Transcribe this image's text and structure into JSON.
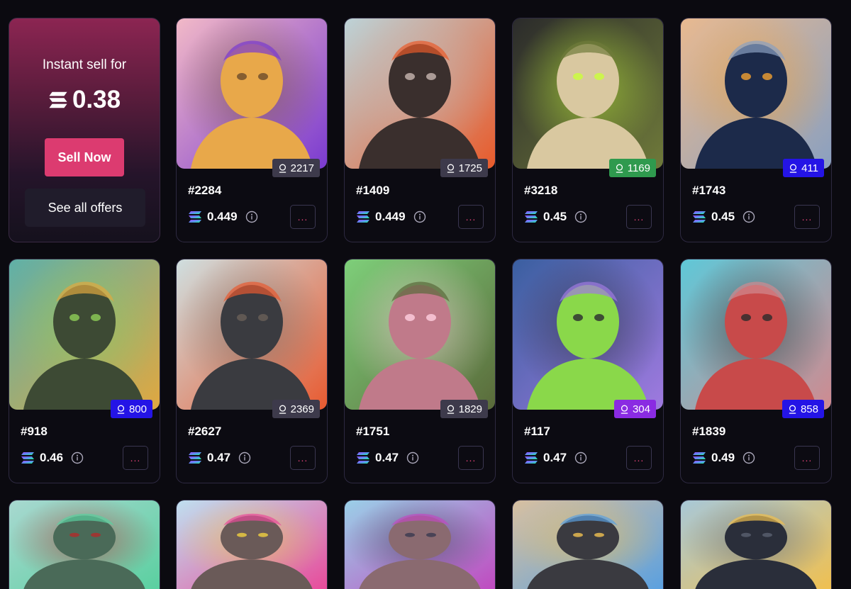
{
  "promo": {
    "title": "Instant sell for",
    "price": "0.38",
    "sell_label": "Sell Now",
    "offers_label": "See all offers"
  },
  "colors": {
    "badge_gray": "#3d3a4b",
    "badge_green": "#2f9a4e",
    "badge_blue": "#2414e6",
    "badge_purple": "#8a2be2",
    "accent_pink": "#dc3b70"
  },
  "icons": {
    "currency": "solana-icon",
    "rank": "ranking-icon",
    "info": "info-icon",
    "more": "more-dots-icon"
  },
  "cards": [
    {
      "id": "#2284",
      "rank": "2217",
      "price": "0.449",
      "badge": "gray",
      "more": "..."
    },
    {
      "id": "#1409",
      "rank": "1725",
      "price": "0.449",
      "badge": "gray",
      "more": "..."
    },
    {
      "id": "#3218",
      "rank": "1169",
      "price": "0.45",
      "badge": "green",
      "more": "..."
    },
    {
      "id": "#1743",
      "rank": "411",
      "price": "0.45",
      "badge": "blue",
      "more": "..."
    },
    {
      "id": "#918",
      "rank": "800",
      "price": "0.46",
      "badge": "blue",
      "more": "..."
    },
    {
      "id": "#2627",
      "rank": "2369",
      "price": "0.47",
      "badge": "gray",
      "more": "..."
    },
    {
      "id": "#1751",
      "rank": "1829",
      "price": "0.47",
      "badge": "gray",
      "more": "..."
    },
    {
      "id": "#117",
      "rank": "304",
      "price": "0.47",
      "badge": "purple",
      "more": "..."
    },
    {
      "id": "#1839",
      "rank": "858",
      "price": "0.49",
      "badge": "blue",
      "more": "..."
    }
  ]
}
